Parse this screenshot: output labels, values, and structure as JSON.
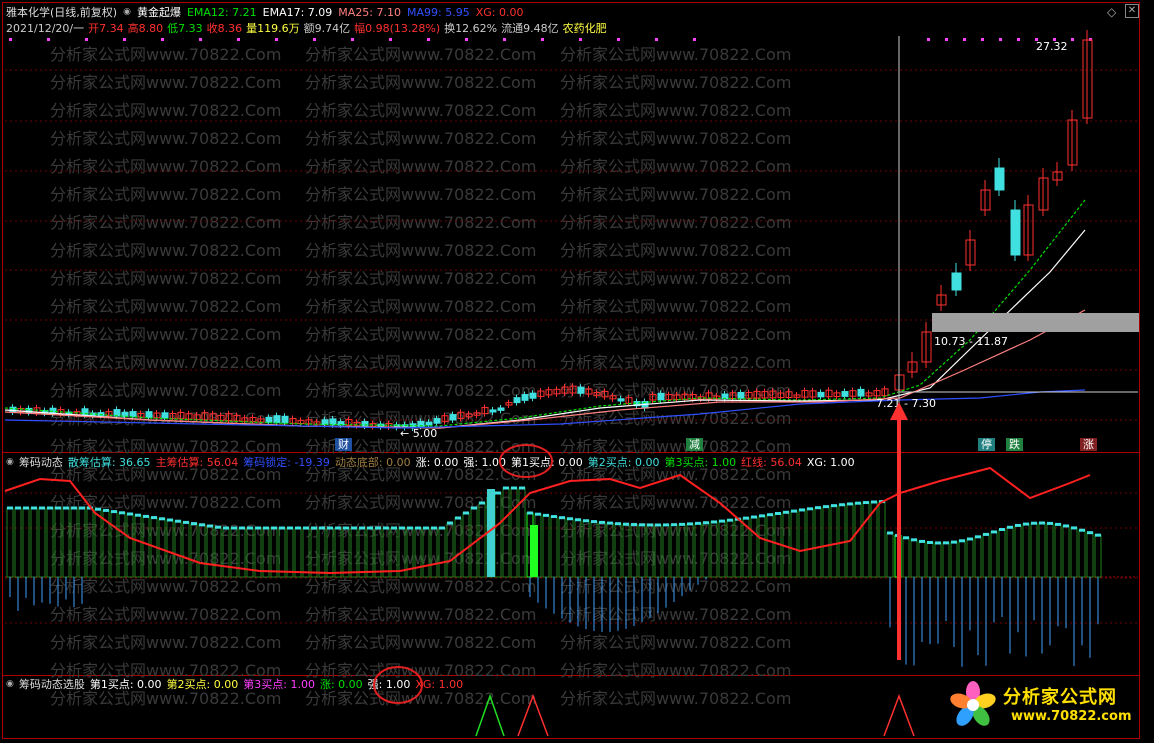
{
  "header": {
    "stock_name": "雅本化学(日线,前复权)",
    "indicator_name": "黄金起爆",
    "ema12": {
      "label": "EMA12:",
      "value": "7.21",
      "color": "#00e000"
    },
    "ema17": {
      "label": "EMA17:",
      "value": "7.09",
      "color": "#ffffff"
    },
    "ma25": {
      "label": "MA25:",
      "value": "7.10",
      "color": "#ff8080"
    },
    "ma99": {
      "label": "MA99:",
      "value": "5.95",
      "color": "#3050ff"
    },
    "xg": {
      "label": "XG:",
      "value": "0.00",
      "color": "#ff3030"
    }
  },
  "quote": {
    "date": "2021/12/20/一",
    "open": "开7.34",
    "high": "高8.80",
    "low": "低7.33",
    "close": "收8.36",
    "volume": "量119.6万",
    "amount": "额9.74亿",
    "change": "幅0.98(13.28%)",
    "turnover": "换12.62%",
    "float": "流通9.48亿",
    "sector": "农药化肥"
  },
  "price_chart": {
    "high_label": "27.32",
    "box_label": "10.73 - 11.87",
    "low_label": "7.21 - 7.30",
    "arrow_label": "← 5.00",
    "markers": {
      "cai": "财",
      "jian": "减",
      "ting": "停",
      "die": "跌",
      "zhang": "涨"
    },
    "colors": {
      "up": "#ff3030",
      "down": "#40e0e0",
      "ema12": "#00e000",
      "ema17": "#ffffff",
      "ma25": "#ff8080",
      "ma99": "#3050ff"
    }
  },
  "chip_panel": {
    "title": "筹码动态",
    "fields": [
      {
        "label": "散筹估算:",
        "value": "36.65",
        "color": "#40e0e0"
      },
      {
        "label": "主筹估算:",
        "value": "56.04",
        "color": "#ff3030"
      },
      {
        "label": "筹码锁定:",
        "value": "-19.39",
        "color": "#3050ff"
      },
      {
        "label": "动态底部:",
        "value": "0.00",
        "color": "#a08040"
      },
      {
        "label": "涨:",
        "value": "0.00",
        "color": "#ffffff"
      },
      {
        "label": "强:",
        "value": "1.00",
        "color": "#ffffff"
      },
      {
        "label": "第1买点:",
        "value": "0.00",
        "color": "#ffffff"
      },
      {
        "label": "第2买点:",
        "value": "0.00",
        "color": "#40e0e0"
      },
      {
        "label": "第3买点:",
        "value": "1.00",
        "color": "#00e000"
      },
      {
        "label": "红线:",
        "value": "56.04",
        "color": "#ff3030"
      },
      {
        "label": "XG:",
        "value": "1.00",
        "color": "#ffffff"
      }
    ]
  },
  "select_panel": {
    "title": "筹码动态选股",
    "fields": [
      {
        "label": "第1买点:",
        "value": "0.00",
        "color": "#ffffff"
      },
      {
        "label": "第2买点:",
        "value": "0.00",
        "color": "#ffff40"
      },
      {
        "label": "第3买点:",
        "value": "1.00",
        "color": "#ff40ff"
      },
      {
        "label": "涨:",
        "value": "0.00",
        "color": "#00e000"
      },
      {
        "label": "强:",
        "value": "1.00",
        "color": "#ffffff"
      },
      {
        "label": "XG:",
        "value": "1.00",
        "color": "#ff3030"
      }
    ]
  },
  "watermark": "分析家公式网www.70822.Com",
  "logo": {
    "cn": "分析家公式网",
    "url": "www.70822.com"
  }
}
